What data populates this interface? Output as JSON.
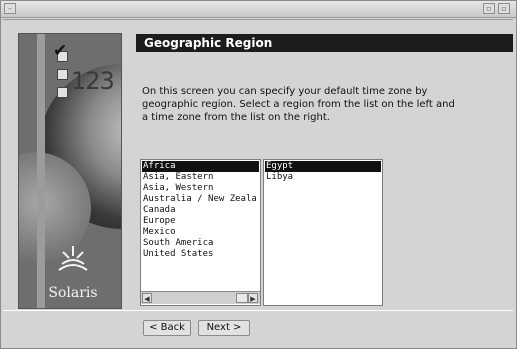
{
  "window": {
    "menu_icon": "window-menu-icon",
    "minimize_icon": "minimize-icon",
    "maximize_icon": "maximize-icon"
  },
  "side_panel": {
    "progress_number": "123",
    "brand": "Solaris",
    "logo_icon": "sun-logo-icon"
  },
  "heading": "Geographic Region",
  "instructions": "On this screen you can specify your default time zone by\ngeographic region.  Select a region from the list on the left and\na time zone from the list on the right.",
  "regions": {
    "items": [
      {
        "label": "Africa",
        "selected": true
      },
      {
        "label": "Asia, Eastern",
        "selected": false
      },
      {
        "label": "Asia, Western",
        "selected": false
      },
      {
        "label": "Australia / New Zeala",
        "selected": false
      },
      {
        "label": "Canada",
        "selected": false
      },
      {
        "label": "Europe",
        "selected": false
      },
      {
        "label": "Mexico",
        "selected": false
      },
      {
        "label": "South America",
        "selected": false
      },
      {
        "label": "United States",
        "selected": false
      }
    ]
  },
  "time_zones": {
    "items": [
      {
        "label": "Egypt",
        "selected": true
      },
      {
        "label": "Libya",
        "selected": false
      }
    ]
  },
  "buttons": {
    "back": "< Back",
    "next": "Next >"
  },
  "colors": {
    "heading_bg": "#1c1c1c",
    "selection_bg": "#111111",
    "window_bg": "#d4d4d4"
  }
}
